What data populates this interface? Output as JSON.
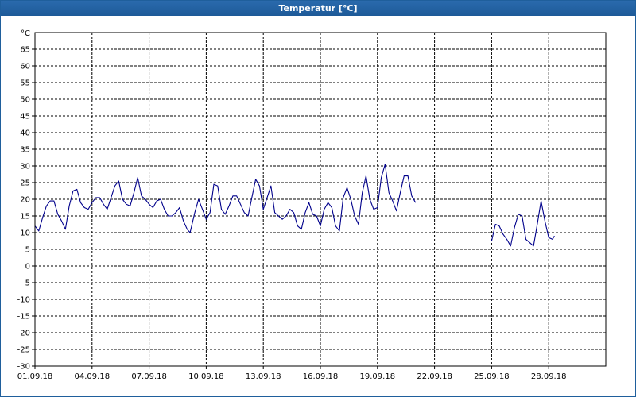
{
  "window": {
    "title": "Temperatur [°C]"
  },
  "chart_data": {
    "type": "line",
    "title": "Temperatur [°C]",
    "ylabel": "°C",
    "xlabel": "",
    "ylim": [
      -30,
      70
    ],
    "yticks": [
      65,
      60,
      55,
      50,
      45,
      40,
      35,
      30,
      25,
      20,
      15,
      10,
      5,
      0,
      -5,
      -10,
      -15,
      -20,
      -25,
      -30
    ],
    "xlim_days": [
      1,
      31
    ],
    "xtick_labels": [
      "01.09.18",
      "04.09.18",
      "07.09.18",
      "10.09.18",
      "13.09.18",
      "16.09.18",
      "19.09.18",
      "22.09.18",
      "25.09.18",
      "28.09.18"
    ],
    "xtick_days": [
      1,
      4,
      7,
      10,
      13,
      16,
      19,
      22,
      25,
      28
    ],
    "grid": true,
    "line_color": "#00008b",
    "series": [
      {
        "name": "",
        "segments": [
          [
            [
              1.0,
              12.0
            ],
            [
              1.2,
              10.5
            ],
            [
              1.4,
              14.5
            ],
            [
              1.6,
              18.0
            ],
            [
              1.8,
              19.5
            ],
            [
              2.0,
              19.5
            ],
            [
              2.2,
              15.5
            ],
            [
              2.4,
              13.5
            ],
            [
              2.6,
              11.0
            ],
            [
              2.8,
              18.0
            ],
            [
              3.0,
              22.5
            ],
            [
              3.2,
              23.0
            ],
            [
              3.4,
              19.0
            ],
            [
              3.6,
              17.5
            ],
            [
              3.8,
              17.0
            ],
            [
              4.0,
              19.0
            ],
            [
              4.2,
              20.5
            ],
            [
              4.4,
              20.5
            ],
            [
              4.6,
              18.5
            ],
            [
              4.8,
              17.0
            ],
            [
              5.0,
              20.5
            ],
            [
              5.2,
              24.0
            ],
            [
              5.4,
              25.5
            ],
            [
              5.6,
              20.0
            ],
            [
              5.8,
              18.5
            ],
            [
              6.0,
              18.0
            ],
            [
              6.2,
              22.0
            ],
            [
              6.4,
              26.5
            ],
            [
              6.6,
              21.0
            ],
            [
              6.8,
              20.0
            ],
            [
              7.0,
              18.5
            ],
            [
              7.2,
              17.5
            ],
            [
              7.4,
              19.5
            ],
            [
              7.6,
              20.0
            ],
            [
              7.8,
              17.0
            ],
            [
              8.0,
              15.0
            ],
            [
              8.2,
              15.0
            ],
            [
              8.4,
              16.0
            ],
            [
              8.6,
              17.5
            ],
            [
              8.8,
              13.5
            ],
            [
              9.0,
              11.0
            ],
            [
              9.15,
              10.0
            ],
            [
              9.4,
              16.0
            ],
            [
              9.6,
              20.0
            ],
            [
              9.8,
              17.0
            ],
            [
              10.0,
              14.0
            ],
            [
              10.2,
              16.0
            ],
            [
              10.4,
              24.5
            ],
            [
              10.6,
              24.0
            ],
            [
              10.8,
              17.0
            ],
            [
              11.0,
              15.5
            ],
            [
              11.2,
              18.0
            ],
            [
              11.4,
              21.0
            ],
            [
              11.6,
              21.0
            ],
            [
              11.8,
              18.5
            ],
            [
              12.0,
              16.0
            ],
            [
              12.2,
              15.0
            ],
            [
              12.4,
              20.5
            ],
            [
              12.6,
              26.0
            ],
            [
              12.8,
              24.0
            ],
            [
              13.0,
              17.0
            ],
            [
              13.2,
              20.5
            ],
            [
              13.4,
              24.0
            ],
            [
              13.6,
              16.0
            ],
            [
              13.8,
              15.0
            ],
            [
              14.0,
              14.0
            ],
            [
              14.2,
              15.0
            ],
            [
              14.4,
              17.0
            ],
            [
              14.6,
              16.0
            ],
            [
              14.8,
              12.0
            ],
            [
              15.0,
              11.0
            ],
            [
              15.2,
              16.0
            ],
            [
              15.4,
              19.0
            ],
            [
              15.6,
              15.5
            ],
            [
              15.8,
              15.0
            ],
            [
              16.0,
              12.0
            ],
            [
              16.2,
              17.0
            ],
            [
              16.4,
              19.0
            ],
            [
              16.6,
              17.5
            ],
            [
              16.8,
              12.0
            ],
            [
              17.0,
              10.5
            ],
            [
              17.2,
              20.5
            ],
            [
              17.4,
              23.5
            ],
            [
              17.6,
              20.0
            ],
            [
              17.8,
              15.0
            ],
            [
              18.0,
              12.5
            ],
            [
              18.2,
              22.0
            ],
            [
              18.4,
              27.0
            ],
            [
              18.6,
              20.0
            ],
            [
              18.8,
              17.0
            ],
            [
              19.0,
              17.5
            ],
            [
              19.2,
              26.5
            ],
            [
              19.4,
              30.5
            ],
            [
              19.6,
              22.0
            ],
            [
              19.8,
              19.5
            ],
            [
              20.0,
              16.5
            ],
            [
              20.2,
              22.0
            ],
            [
              20.4,
              27.0
            ],
            [
              20.6,
              27.0
            ],
            [
              20.8,
              21.0
            ],
            [
              21.0,
              19.0
            ]
          ],
          [
            [
              25.0,
              7.5
            ],
            [
              25.2,
              12.5
            ],
            [
              25.4,
              12.0
            ],
            [
              25.6,
              9.5
            ],
            [
              25.8,
              8.0
            ],
            [
              26.0,
              6.0
            ],
            [
              26.2,
              11.5
            ],
            [
              26.4,
              15.5
            ],
            [
              26.6,
              15.0
            ],
            [
              26.8,
              8.0
            ],
            [
              27.0,
              7.0
            ],
            [
              27.2,
              6.0
            ],
            [
              27.4,
              12.5
            ],
            [
              27.6,
              19.5
            ],
            [
              27.8,
              13.5
            ],
            [
              28.0,
              8.5
            ],
            [
              28.2,
              8.0
            ],
            [
              28.3,
              9.0
            ]
          ]
        ]
      }
    ]
  }
}
